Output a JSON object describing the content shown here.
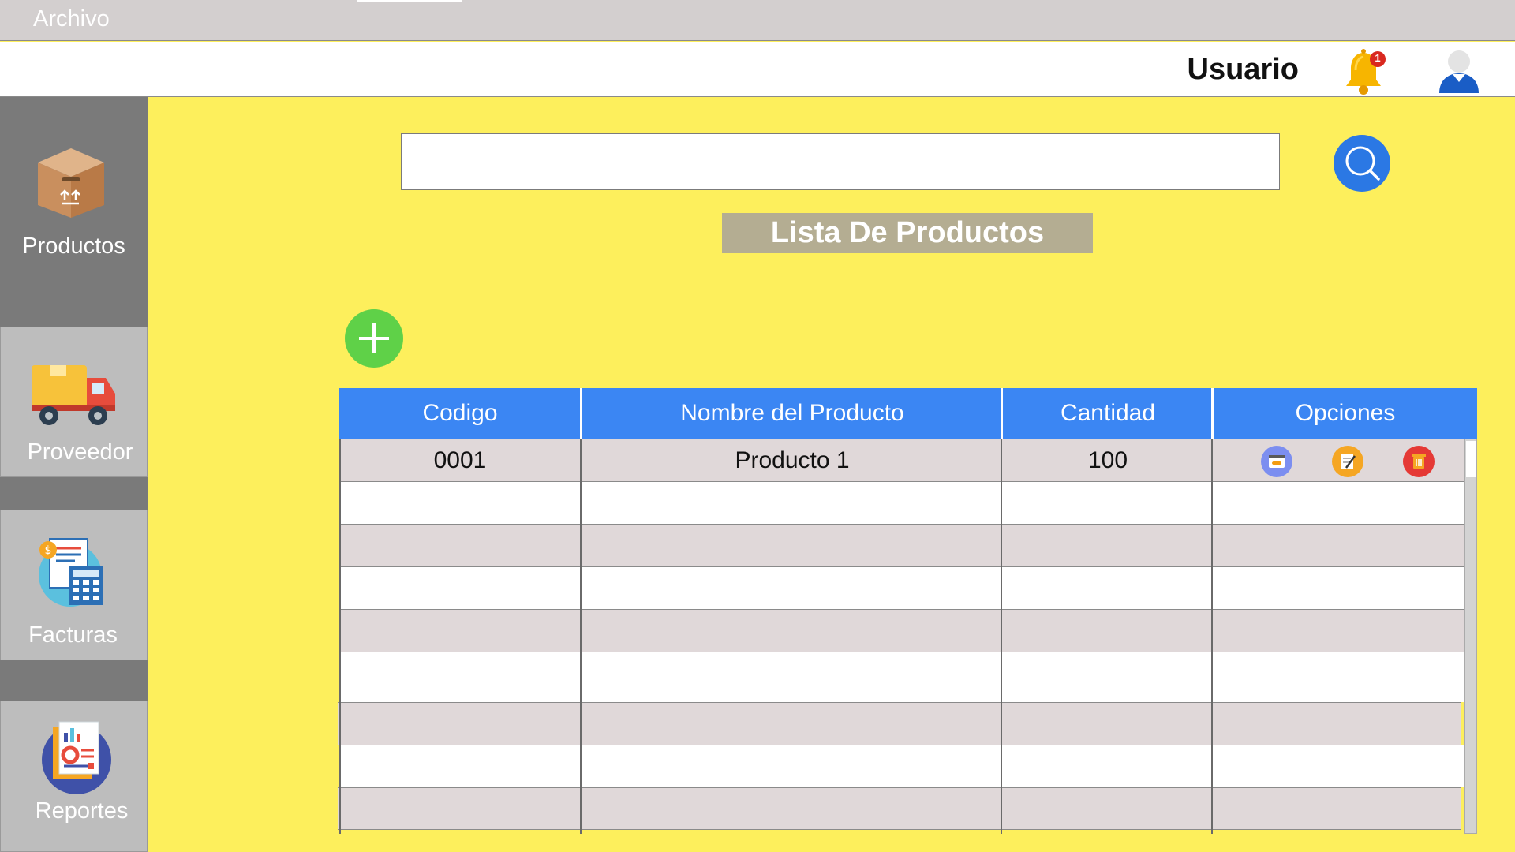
{
  "menubar": {
    "archivo_label": "Archivo"
  },
  "header": {
    "username": "Usuario",
    "notification_count": "1"
  },
  "sidebar": {
    "items": [
      {
        "label": "Productos",
        "icon": "box-icon"
      },
      {
        "label": "Proveedor",
        "icon": "truck-icon"
      },
      {
        "label": "Facturas",
        "icon": "invoice-calculator-icon"
      },
      {
        "label": "Reportes",
        "icon": "report-icon"
      }
    ]
  },
  "search": {
    "value": "",
    "placeholder": ""
  },
  "main": {
    "title": "Lista De Productos"
  },
  "table": {
    "headers": [
      "Codigo",
      "Nombre del Producto",
      "Cantidad",
      "Opciones"
    ],
    "rows": [
      [
        "0001",
        "Producto 1",
        "100"
      ],
      [
        "",
        "",
        ""
      ],
      [
        "",
        "",
        ""
      ],
      [
        "",
        "",
        ""
      ],
      [
        "",
        "",
        ""
      ],
      [
        "",
        "",
        ""
      ],
      [
        "",
        "",
        ""
      ],
      [
        "",
        "",
        ""
      ],
      [
        "",
        "",
        ""
      ]
    ],
    "row_options_icons": [
      "view-icon",
      "edit-icon",
      "delete-icon"
    ]
  },
  "colors": {
    "background": "#fdef5c",
    "header_blue": "#3b86f3",
    "search_button": "#2b78e4",
    "add_button": "#5fd148",
    "title_box": "#b4ad92",
    "sidebar": "#7a7a7a",
    "sidebar_item": "#bdbdbd"
  }
}
